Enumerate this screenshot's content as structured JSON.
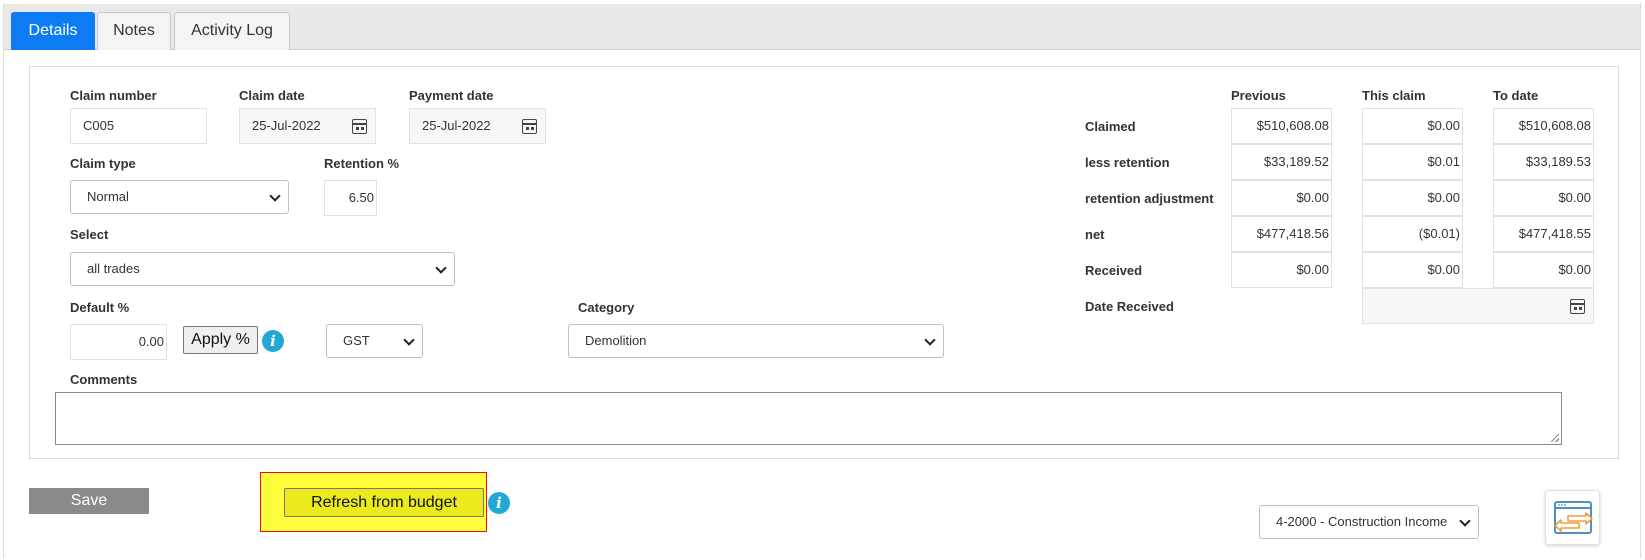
{
  "tabs": [
    {
      "label": "Details",
      "active": true
    },
    {
      "label": "Notes",
      "active": false
    },
    {
      "label": "Activity Log",
      "active": false
    }
  ],
  "form": {
    "claim_number": {
      "label": "Claim number",
      "value": "C005"
    },
    "claim_date": {
      "label": "Claim date",
      "value": "25-Jul-2022"
    },
    "payment_date": {
      "label": "Payment date",
      "value": "25-Jul-2022"
    },
    "claim_type": {
      "label": "Claim type",
      "value": "Normal"
    },
    "retention": {
      "label": "Retention %",
      "value": "6.50"
    },
    "select": {
      "label": "Select",
      "value": "all trades"
    },
    "default_pct": {
      "label": "Default %",
      "value": "0.00"
    },
    "apply_label": "Apply %",
    "tax": {
      "value": "GST"
    },
    "category": {
      "label": "Category",
      "value": "Demolition"
    },
    "comments": {
      "label": "Comments",
      "value": ""
    }
  },
  "summary": {
    "columns": [
      "Previous",
      "This claim",
      "To date"
    ],
    "rows": [
      {
        "label": "Claimed",
        "values": [
          "$510,608.08",
          "$0.00",
          "$510,608.08"
        ]
      },
      {
        "label": "less retention",
        "values": [
          "$33,189.52",
          "$0.01",
          "$33,189.53"
        ]
      },
      {
        "label": "retention adjustment",
        "values": [
          "$0.00",
          "$0.00",
          "$0.00"
        ]
      },
      {
        "label": "net",
        "values": [
          "$477,418.56",
          "($0.01)",
          "$477,418.55"
        ]
      },
      {
        "label": "Received",
        "values": [
          "$0.00",
          "$0.00",
          "$0.00"
        ]
      }
    ],
    "date_received": {
      "label": "Date Received",
      "value": ""
    }
  },
  "footer": {
    "save_label": "Save",
    "refresh_label": "Refresh from budget",
    "account": "4-2000 - Construction Income"
  },
  "colors": {
    "active_tab": "#0d7bf2",
    "info_icon": "#22a8d4",
    "highlight_fill": "#ffff3c",
    "highlight_border": "#e81010",
    "save_button": "#8a8a8a"
  }
}
